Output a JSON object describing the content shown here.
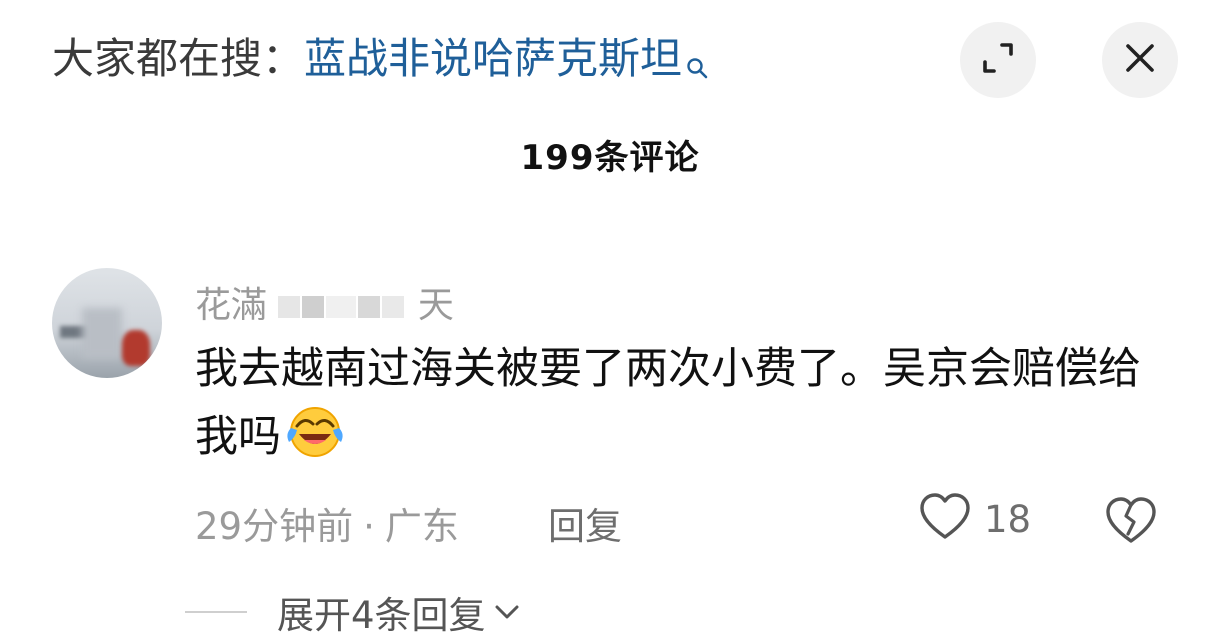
{
  "header": {
    "search_prefix": "大家都在搜：",
    "search_term": "蓝战非说哈萨克斯坦",
    "search_icon": "search-icon",
    "expand_icon": "expand-icon",
    "close_icon": "close-icon"
  },
  "comments_header": {
    "count_title": "199条评论"
  },
  "comment": {
    "username_start": "花滿",
    "username_end": "天",
    "text": "我去越南过海关被要了两次小费了。吴京会赔偿给我吗",
    "emoji": "crying-laughing-emoji",
    "time": "29分钟前",
    "separator": "·",
    "location": "广东",
    "reply_label": "回复",
    "like_count": "18",
    "like_icon": "heart-icon",
    "dislike_icon": "broken-heart-icon"
  },
  "expand_replies": {
    "label": "展开4条回复"
  },
  "colors": {
    "search_term": "#1f5f99",
    "muted": "#9a9a9a",
    "button_bg": "#f1f1f1"
  }
}
